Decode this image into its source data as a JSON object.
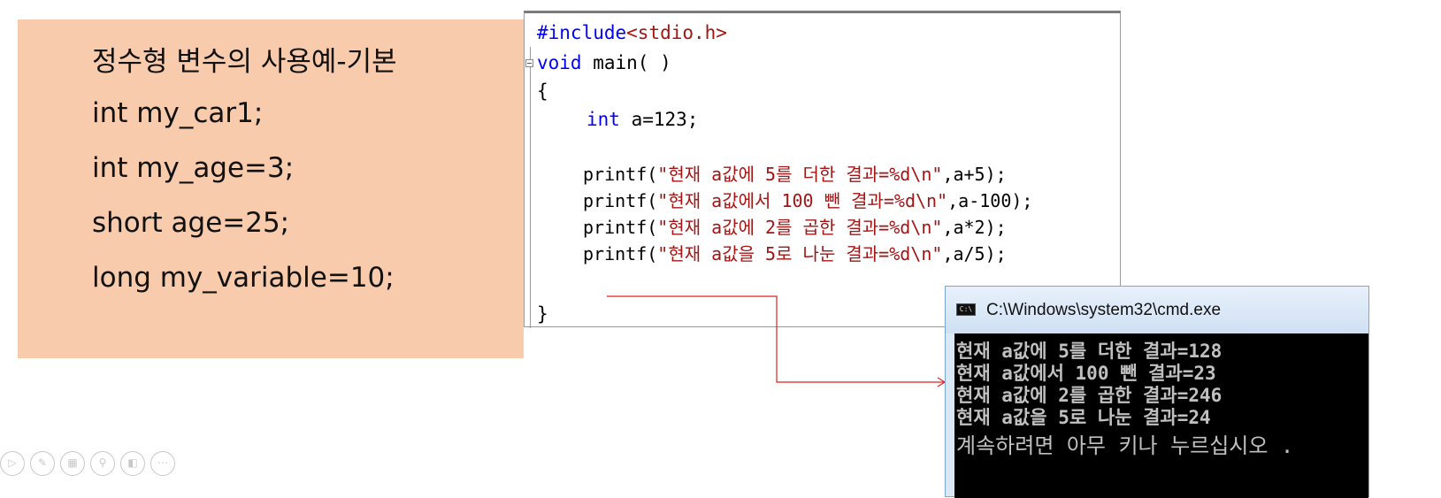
{
  "note": {
    "lines": [
      "정수형 변수의 사용예-기본",
      "int my_car1;",
      "int my_age=3;",
      "short age=25;",
      "long my_variable=10;"
    ]
  },
  "editor": {
    "include_directive": "#include",
    "include_header": "<stdio.h>",
    "void_kw": "void",
    "main_sig": " main( )",
    "open_brace": "{",
    "int_kw": "int",
    "decl_rest": " a=123;",
    "printf_calls": [
      {
        "prefix": "printf(",
        "str": "\"현재 a값에 5를 더한 결과=%d\\n\"",
        "suffix": ",a+5);"
      },
      {
        "prefix": "printf(",
        "str": "\"현재 a값에서 100 뺀 결과=%d\\n\"",
        "suffix": ",a-100);"
      },
      {
        "prefix": "printf(",
        "str": "\"현재 a값에 2를 곱한 결과=%d\\n\"",
        "suffix": ",a*2);"
      },
      {
        "prefix": "printf(",
        "str": "\"현재 a값을 5로 나눈 결과=%d\\n\"",
        "suffix": ",a/5);"
      }
    ],
    "close_brace": "}"
  },
  "console": {
    "title": "C:\\Windows\\system32\\cmd.exe",
    "icon_label": "C:\\",
    "lines": [
      "현재 a값에 5를 더한 결과=128",
      "현재 a값에서 100 뺀 결과=23",
      "현재 a값에 2를 곱한 결과=246",
      "현재 a값을 5로 나눈 결과=24",
      "계속하려면 아무 키나 누르십시오 ."
    ]
  },
  "slide_controls": [
    "▷",
    "✎",
    "▦",
    "⚲",
    "◧",
    "⋯"
  ],
  "colors": {
    "note_bg": "#f8cbad",
    "keyword": "#0000ff",
    "string": "#a31515",
    "arrow": "#e02020",
    "console_bg": "#000000"
  }
}
